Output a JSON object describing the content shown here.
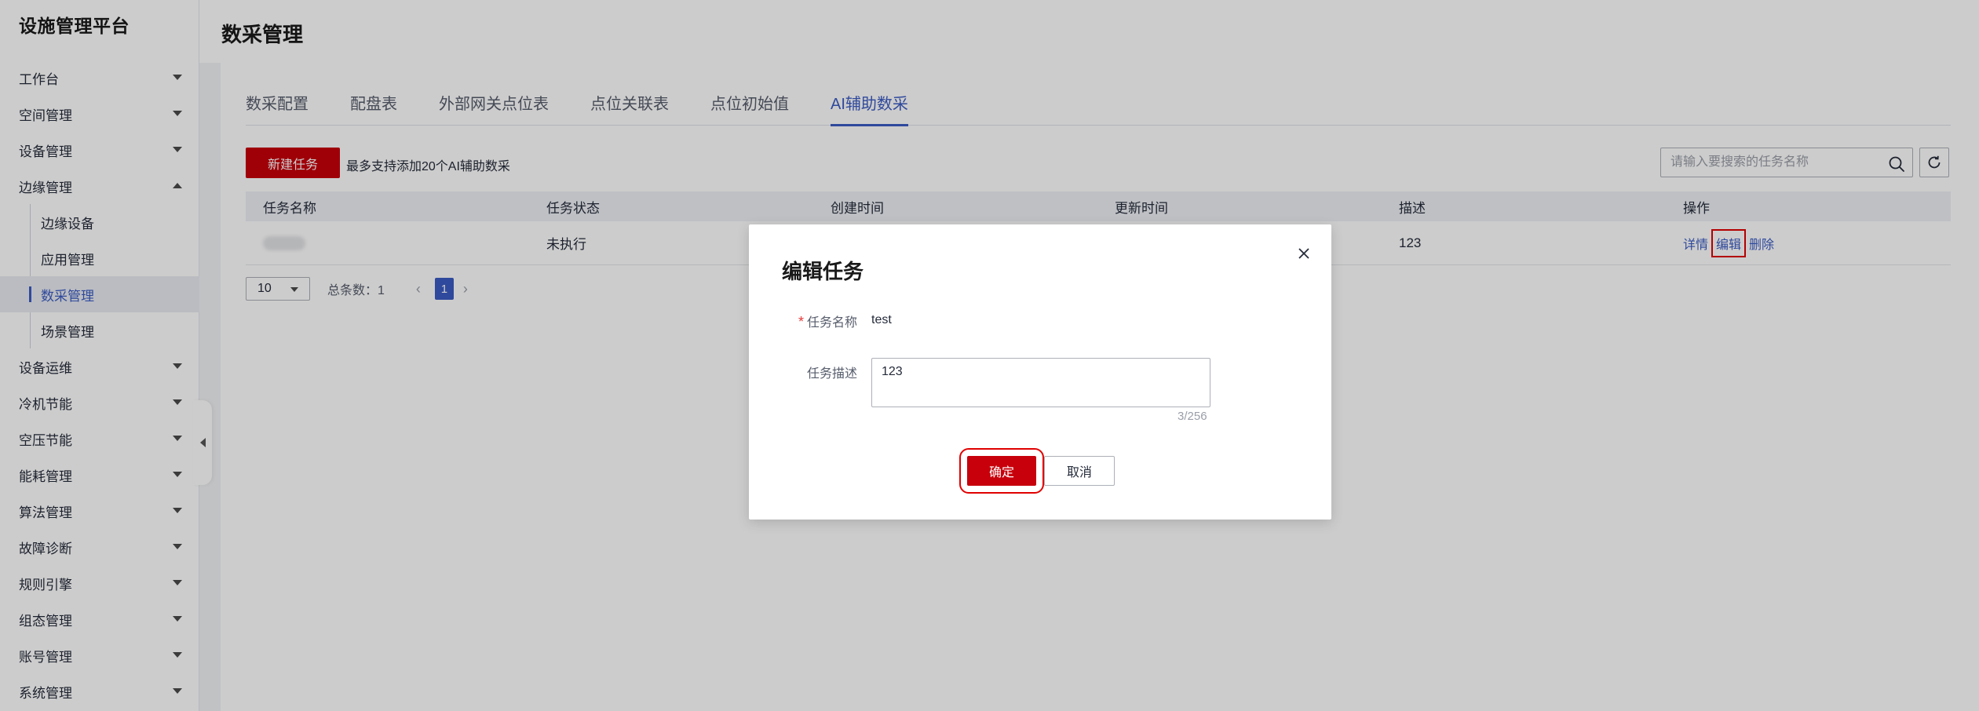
{
  "sidebar": {
    "brand": "设施管理平台",
    "items": [
      {
        "label": "工作台"
      },
      {
        "label": "空间管理"
      },
      {
        "label": "设备管理"
      },
      {
        "label": "边缘管理"
      },
      {
        "label": "设备运维"
      },
      {
        "label": "冷机节能"
      },
      {
        "label": "空压节能"
      },
      {
        "label": "能耗管理"
      },
      {
        "label": "算法管理"
      },
      {
        "label": "故障诊断"
      },
      {
        "label": "规则引擎"
      },
      {
        "label": "组态管理"
      },
      {
        "label": "账号管理"
      },
      {
        "label": "系统管理"
      }
    ],
    "sub_items": [
      {
        "label": "边缘设备"
      },
      {
        "label": "应用管理"
      },
      {
        "label": "数采管理"
      },
      {
        "label": "场景管理"
      }
    ],
    "active_sub": "数采管理"
  },
  "header": {
    "title": "数采管理"
  },
  "tabs": [
    {
      "label": "数采配置"
    },
    {
      "label": "配盘表"
    },
    {
      "label": "外部网关点位表"
    },
    {
      "label": "点位关联表"
    },
    {
      "label": "点位初始值"
    },
    {
      "label": "AI辅助数采"
    }
  ],
  "active_tab": "AI辅助数采",
  "toolbar": {
    "new_label": "新建任务",
    "hint": "最多支持添加20个AI辅助数采",
    "search_placeholder": "请输入要搜索的任务名称"
  },
  "table": {
    "columns": [
      "任务名称",
      "任务状态",
      "创建时间",
      "更新时间",
      "描述",
      "操作"
    ],
    "rows": [
      {
        "status": "未执行",
        "description": "123",
        "actions": [
          "详情",
          "编辑",
          "删除"
        ]
      }
    ]
  },
  "pagination": {
    "page_size": "10",
    "total": "总条数：1",
    "current": "1",
    "prev": "‹",
    "next": "›"
  },
  "modal": {
    "title": "编辑任务",
    "name_label": "任务名称",
    "name_value": "test",
    "desc_label": "任务描述",
    "desc_value": "123",
    "counter": "3/256",
    "ok_label": "确定",
    "cancel_label": "取消",
    "required_mark": "*"
  },
  "colors": {
    "brand_red": "#c7000b",
    "accent_blue": "#3b5cc4",
    "highlight_red": "#e00000"
  }
}
